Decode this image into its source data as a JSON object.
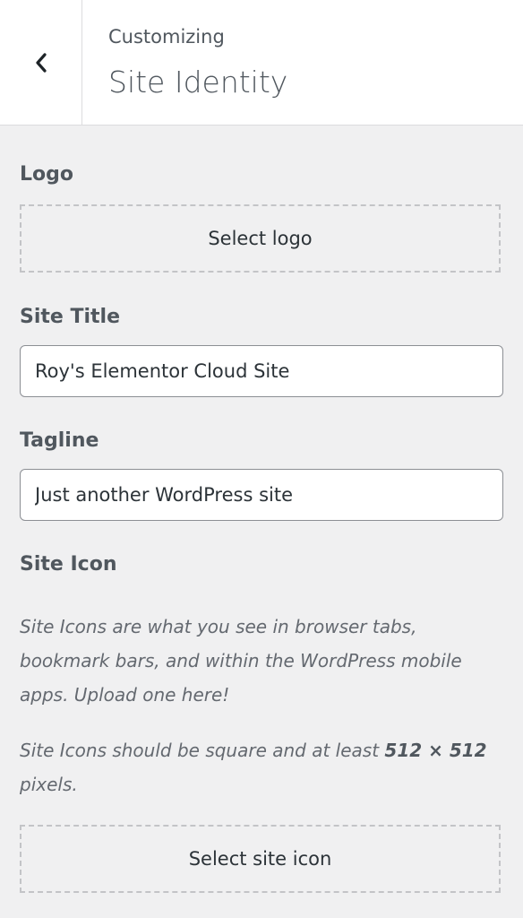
{
  "header": {
    "back_icon": "chevron-left-icon",
    "subtitle": "Customizing",
    "title": "Site Identity"
  },
  "logo": {
    "label": "Logo",
    "button_label": "Select logo"
  },
  "site_title": {
    "label": "Site Title",
    "value": "Roy's Elementor Cloud Site"
  },
  "tagline": {
    "label": "Tagline",
    "value": "Just another WordPress site"
  },
  "site_icon": {
    "label": "Site Icon",
    "description": "Site Icons are what you see in browser tabs, bookmark bars, and within the WordPress mobile apps. Upload one here!",
    "requirement_prefix": "Site Icons should be square and at least ",
    "requirement_size": "512 × 512",
    "requirement_suffix": " pixels.",
    "button_label": "Select site icon"
  },
  "colors": {
    "background": "#f0f0f1",
    "header_background": "#ffffff",
    "text": "#50575e",
    "border": "#8c8f94",
    "dashed_border": "#c3c4c7"
  }
}
